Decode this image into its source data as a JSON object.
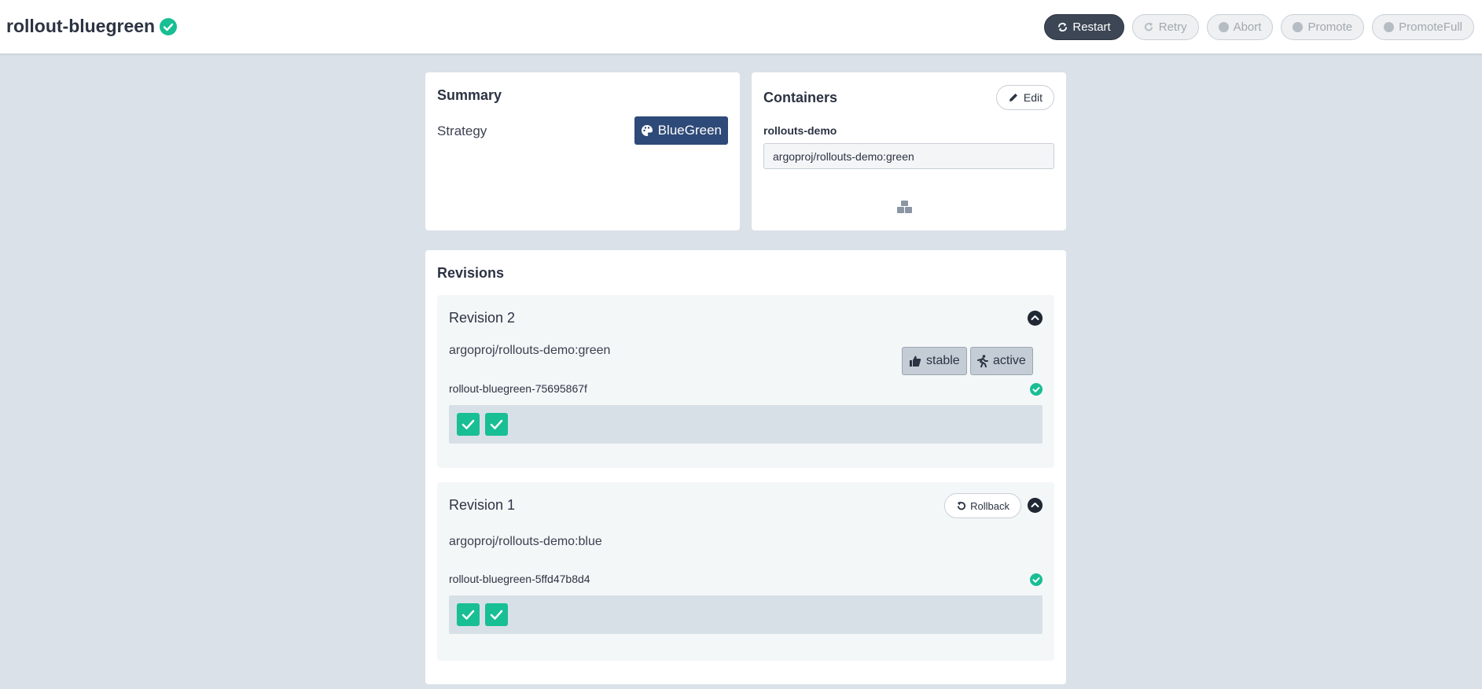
{
  "header": {
    "title": "rollout-bluegreen",
    "buttons": [
      {
        "label": "Restart",
        "icon": "sync-icon",
        "enabled": true
      },
      {
        "label": "Retry",
        "icon": "redo-icon",
        "enabled": false
      },
      {
        "label": "Abort",
        "icon": "exclamation-circle-icon",
        "enabled": false
      },
      {
        "label": "Promote",
        "icon": "chevron-circle-up-icon",
        "enabled": false
      },
      {
        "label": "PromoteFull",
        "icon": "arrow-circle-up-icon",
        "enabled": false
      }
    ]
  },
  "summary": {
    "title": "Summary",
    "strategy_label": "Strategy",
    "strategy_value": "BlueGreen"
  },
  "containers": {
    "title": "Containers",
    "edit_label": "Edit",
    "container_name": "rollouts-demo",
    "container_image": "argoproj/rollouts-demo:green"
  },
  "revisions": {
    "title": "Revisions",
    "items": [
      {
        "title": "Revision 2",
        "image": "argoproj/rollouts-demo:green",
        "badges": [
          "stable",
          "active"
        ],
        "replicaset": "rollout-bluegreen-75695867f",
        "pods": 2
      },
      {
        "title": "Revision 1",
        "image": "argoproj/rollouts-demo:blue",
        "rollback_label": "Rollback",
        "replicaset": "rollout-bluegreen-5ffd47b8d4",
        "pods": 2
      }
    ]
  },
  "colors": {
    "success": "#18be94",
    "strategy": "#2e4a78",
    "background": "#dae1e8"
  }
}
